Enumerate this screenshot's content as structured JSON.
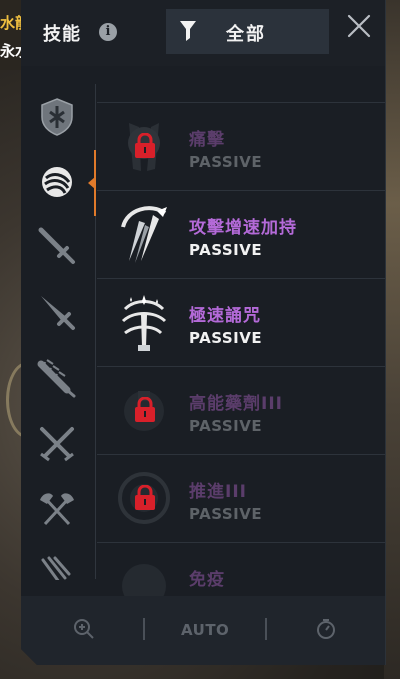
{
  "background": {
    "text_1": "水龍",
    "text_2": "永水"
  },
  "header": {
    "title": "技能",
    "info_glyph": "i",
    "filter_label": "全部"
  },
  "categories": [
    {
      "icon": "shield-icon",
      "selected": false
    },
    {
      "icon": "orb-icon",
      "selected": true
    },
    {
      "icon": "sword-icon",
      "selected": false
    },
    {
      "icon": "dagger-icon",
      "selected": false
    },
    {
      "icon": "spiked-club-icon",
      "selected": false
    },
    {
      "icon": "crossed-swords-icon",
      "selected": false
    },
    {
      "icon": "double-axe-icon",
      "selected": false
    },
    {
      "icon": "claw-icon",
      "selected": false
    }
  ],
  "skills": [
    {
      "name": "痛擊",
      "type": "PASSIVE",
      "locked": true
    },
    {
      "name": "攻擊增速加持",
      "type": "PASSIVE",
      "locked": false
    },
    {
      "name": "極速誦咒",
      "type": "PASSIVE",
      "locked": false
    },
    {
      "name": "高能藥劑III",
      "type": "PASSIVE",
      "locked": true
    },
    {
      "name": "推進III",
      "type": "PASSIVE",
      "locked": true
    },
    {
      "name": "免疫",
      "type": "",
      "locked": true
    }
  ],
  "footer": {
    "auto_label": "AUTO"
  },
  "colors": {
    "accent": "#e07a2a",
    "skill_name": "#b46ad8",
    "lock_red": "#d8202a"
  }
}
